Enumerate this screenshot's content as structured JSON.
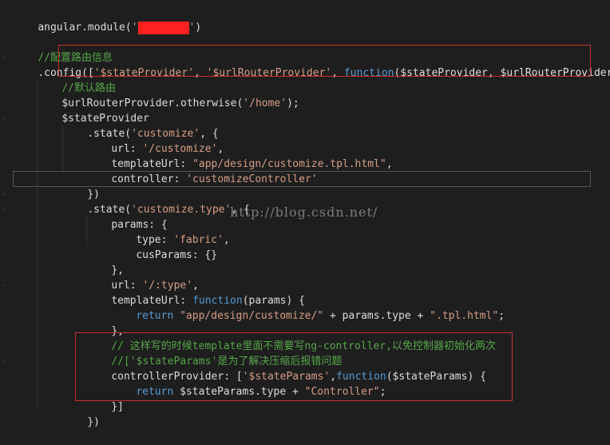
{
  "code": {
    "line1_pre": "angular.module(",
    "line1_q1": "'",
    "line1_q2": "'",
    "line1_post": ")",
    "c1": "//配置路由信息",
    "config_pre": ".config(",
    "config_bracket": "[",
    "s_stateProvider": "'$stateProvider'",
    "comma1": ", ",
    "s_urlRouterProvider": "'$urlRouterProvider'",
    "comma2": ", ",
    "kw_function": "function",
    "config_params": "($stateProvider, $urlRouterProvider) {",
    "c2": "//默认路由",
    "otherwise_pre": "$urlRouterProvider.otherwise(",
    "otherwise_str": "'/home'",
    "otherwise_post": ");",
    "stateProvider": "$stateProvider",
    "state1_pre": ".state(",
    "state1_str": "'customize'",
    "state1_post": ", {",
    "url1_key": "url: ",
    "url1_str": "'/customize'",
    "url1_post": ",",
    "tpl1_key": "templateUrl: ",
    "tpl1_str": "\"app/design/customize.tpl.html\"",
    "tpl1_post": ",",
    "ctrl1_key": "controller: ",
    "ctrl1_str": "'customizeController'",
    "close1": "})",
    "state2_pre": ".state(",
    "state2_str": "'customize.type'",
    "state2_post": ", {",
    "params_key": "params: {",
    "type_key": "type: ",
    "type_str": "'fabric'",
    "type_post": ",",
    "cus_key": "cusParams: {}",
    "params_close": "},",
    "url2_key": "url: ",
    "url2_str": "'/:type'",
    "url2_post": ",",
    "tpl2_key": "templateUrl: ",
    "tpl2_kw": "function",
    "tpl2_params": "(params)",
    "tpl2_post": " {",
    "ret_kw": "return ",
    "ret_str1": "\"app/design/customize/\"",
    "ret_mid": " + params.type + ",
    "ret_str2": "\".tpl.html\"",
    "ret_post": ";",
    "fn_close": "},",
    "c3": "// 这样写的时候template里面不需要写ng-controller,以免控制器初始化两次",
    "c4": "//['$stateParams'是为了解决压缩后报错问题",
    "cp_key": "controllerProvider: [",
    "cp_str": "'$stateParams'",
    "cp_comma": ",",
    "cp_kw": "function",
    "cp_params": "($stateParams)",
    "cp_post": " {",
    "ret2_kw": "return ",
    "ret2_mid": "$stateParams.type + ",
    "ret2_str": "\"Controller\"",
    "ret2_post": ";",
    "cp_close": "}]",
    "last": "})"
  },
  "watermark": "http://blog.csdn.net/"
}
